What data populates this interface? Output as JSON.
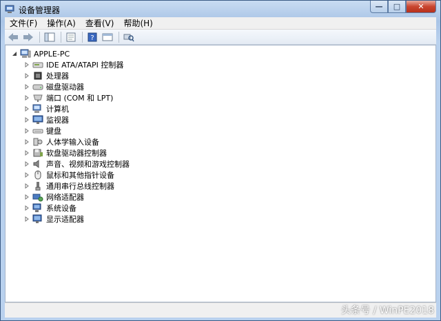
{
  "window": {
    "title": "设备管理器",
    "caption": {
      "minimize": "—",
      "maximize": "□",
      "close": "✕"
    }
  },
  "menu": [
    {
      "label": "文件(F)"
    },
    {
      "label": "操作(A)"
    },
    {
      "label": "查看(V)"
    },
    {
      "label": "帮助(H)"
    }
  ],
  "toolbar": {
    "buttons": [
      "back-arrow-icon",
      "forward-arrow-icon",
      "show-hide-tree-icon",
      "properties-icon",
      "help-icon",
      "view-icon",
      "scan-hardware-icon"
    ]
  },
  "tree": {
    "root": {
      "label": "APPLE-PC",
      "icon": "computer-icon",
      "expanded": true
    },
    "items": [
      {
        "label": "IDE ATA/ATAPI 控制器",
        "icon": "ide-controller-icon"
      },
      {
        "label": "处理器",
        "icon": "processor-icon"
      },
      {
        "label": "磁盘驱动器",
        "icon": "disk-drive-icon"
      },
      {
        "label": "端口 (COM 和 LPT)",
        "icon": "port-icon"
      },
      {
        "label": "计算机",
        "icon": "computer-icon"
      },
      {
        "label": "监视器",
        "icon": "monitor-icon"
      },
      {
        "label": "键盘",
        "icon": "keyboard-icon"
      },
      {
        "label": "人体学输入设备",
        "icon": "hid-icon"
      },
      {
        "label": "软盘驱动器控制器",
        "icon": "floppy-controller-icon"
      },
      {
        "label": "声音、视频和游戏控制器",
        "icon": "sound-icon"
      },
      {
        "label": "鼠标和其他指针设备",
        "icon": "mouse-icon"
      },
      {
        "label": "通用串行总线控制器",
        "icon": "usb-icon"
      },
      {
        "label": "网络适配器",
        "icon": "network-adapter-icon"
      },
      {
        "label": "系统设备",
        "icon": "system-device-icon"
      },
      {
        "label": "显示适配器",
        "icon": "display-adapter-icon"
      }
    ]
  },
  "watermark": "头条号 / WinPE2018",
  "colors": {
    "titlebar": "#b9d1ee",
    "menubar": "#f0f0f0",
    "content": "#ffffff",
    "close": "#c9452f"
  }
}
